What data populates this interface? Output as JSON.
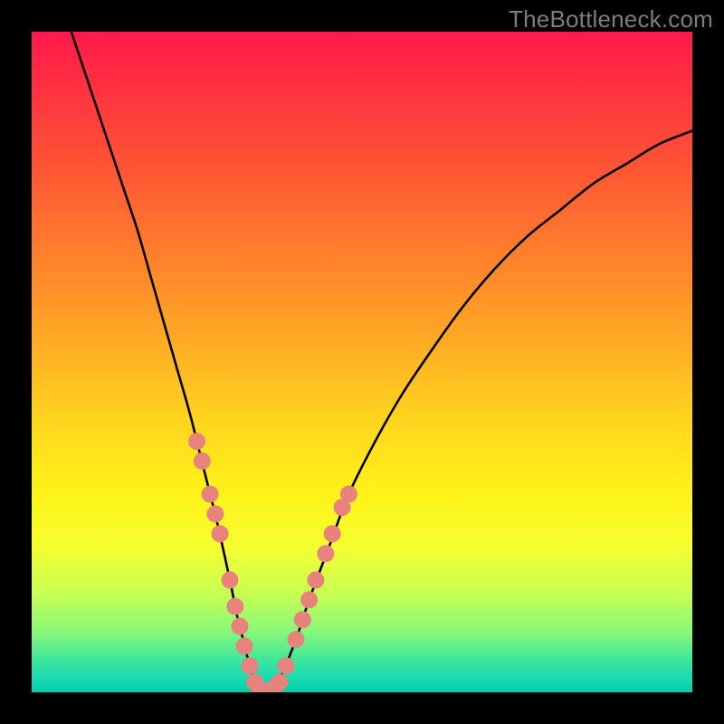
{
  "watermark": "TheBottleneck.com",
  "chart_data": {
    "type": "line",
    "title": "",
    "xlabel": "",
    "ylabel": "",
    "xlim": [
      0,
      100
    ],
    "ylim": [
      0,
      100
    ],
    "grid": false,
    "legend": false,
    "series": [
      {
        "name": "bottleneck-curve",
        "x": [
          6,
          8,
          10,
          12,
          14,
          16,
          18,
          20,
          22,
          24,
          26,
          28,
          30,
          31,
          32,
          33,
          34,
          35,
          36,
          37,
          38,
          40,
          42,
          45,
          48,
          52,
          56,
          60,
          65,
          70,
          75,
          80,
          85,
          90,
          95,
          100
        ],
        "y": [
          100,
          94,
          88,
          82,
          76,
          70,
          63,
          56,
          49,
          42,
          34,
          26,
          17,
          12,
          8,
          4,
          1,
          0,
          0,
          1,
          3,
          8,
          14,
          22,
          30,
          38,
          45,
          51,
          58,
          64,
          69,
          73,
          77,
          80,
          83,
          85
        ],
        "color": "#000000"
      }
    ],
    "dots": {
      "name": "highlight-points",
      "color": "#e8827d",
      "radius_pct": 1.3,
      "points": [
        {
          "x": 25.0,
          "y": 38
        },
        {
          "x": 25.8,
          "y": 35
        },
        {
          "x": 27.0,
          "y": 30
        },
        {
          "x": 27.8,
          "y": 27
        },
        {
          "x": 28.5,
          "y": 24
        },
        {
          "x": 30.0,
          "y": 17
        },
        {
          "x": 30.8,
          "y": 13
        },
        {
          "x": 31.5,
          "y": 10
        },
        {
          "x": 32.2,
          "y": 7
        },
        {
          "x": 33.0,
          "y": 4
        },
        {
          "x": 33.8,
          "y": 1.5
        },
        {
          "x": 34.5,
          "y": 0.5
        },
        {
          "x": 35.5,
          "y": 0
        },
        {
          "x": 36.5,
          "y": 0.5
        },
        {
          "x": 37.5,
          "y": 1.5
        },
        {
          "x": 38.5,
          "y": 4
        },
        {
          "x": 40.0,
          "y": 8
        },
        {
          "x": 41.0,
          "y": 11
        },
        {
          "x": 42.0,
          "y": 14
        },
        {
          "x": 43.0,
          "y": 17
        },
        {
          "x": 44.5,
          "y": 21
        },
        {
          "x": 45.5,
          "y": 24
        },
        {
          "x": 47.0,
          "y": 28
        },
        {
          "x": 48.0,
          "y": 30
        }
      ]
    }
  }
}
